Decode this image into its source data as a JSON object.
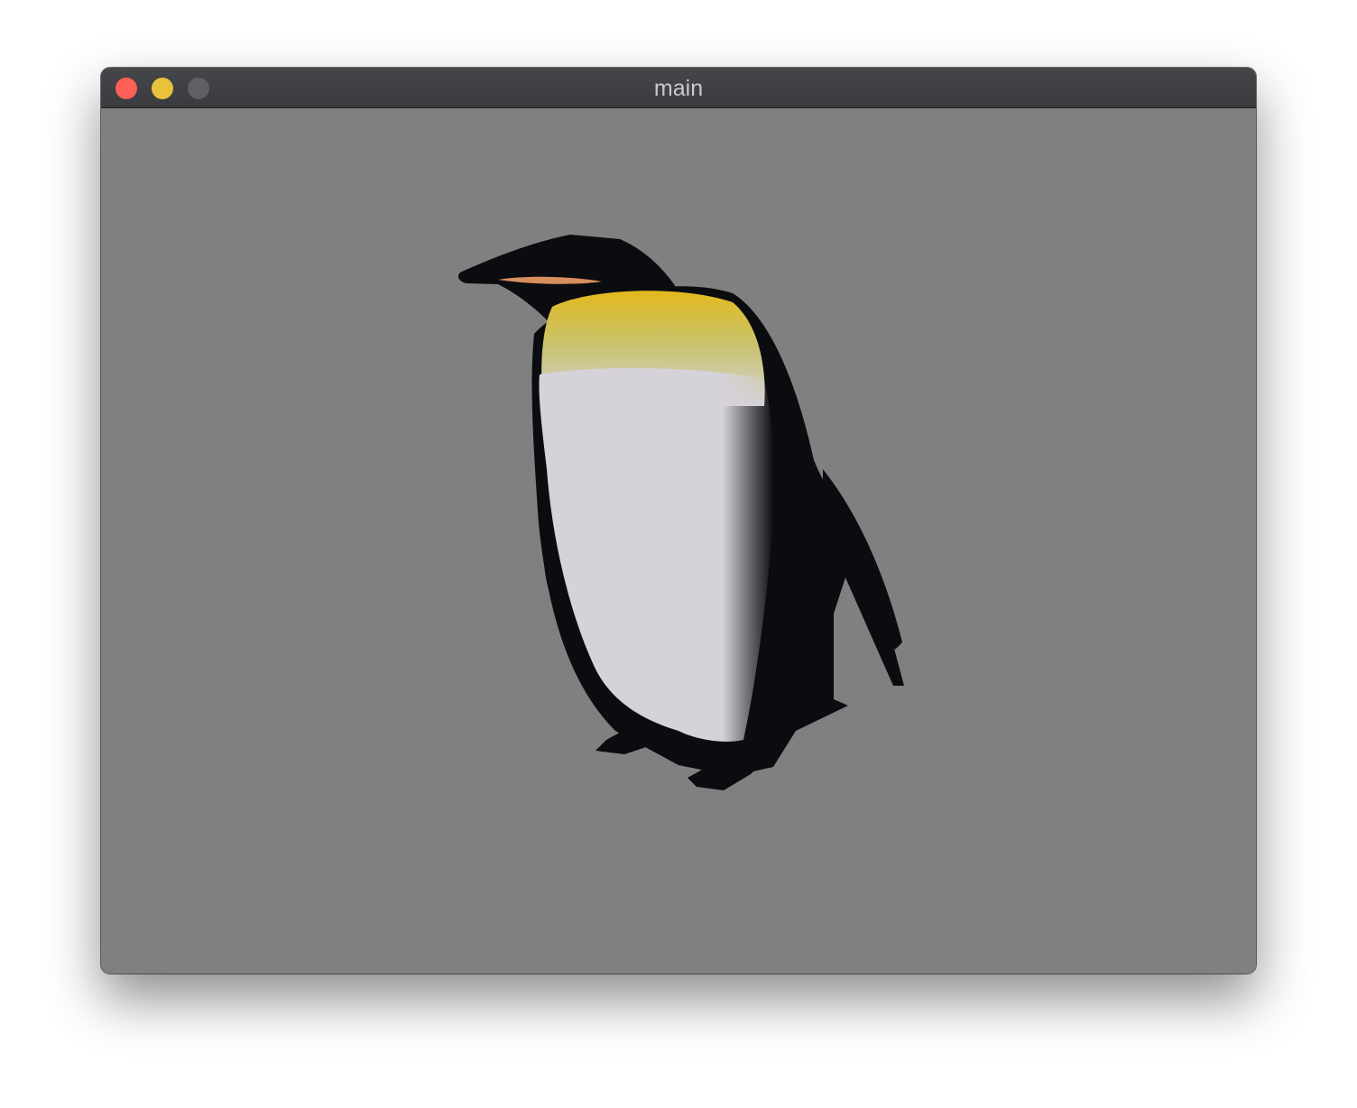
{
  "window": {
    "title": "main"
  },
  "viewport": {
    "background_color": "#808080",
    "subject_icon": "penguin-model"
  },
  "colors": {
    "close": "#fe5f57",
    "minimize": "#e9c23c",
    "zoom": "#5e6064"
  }
}
